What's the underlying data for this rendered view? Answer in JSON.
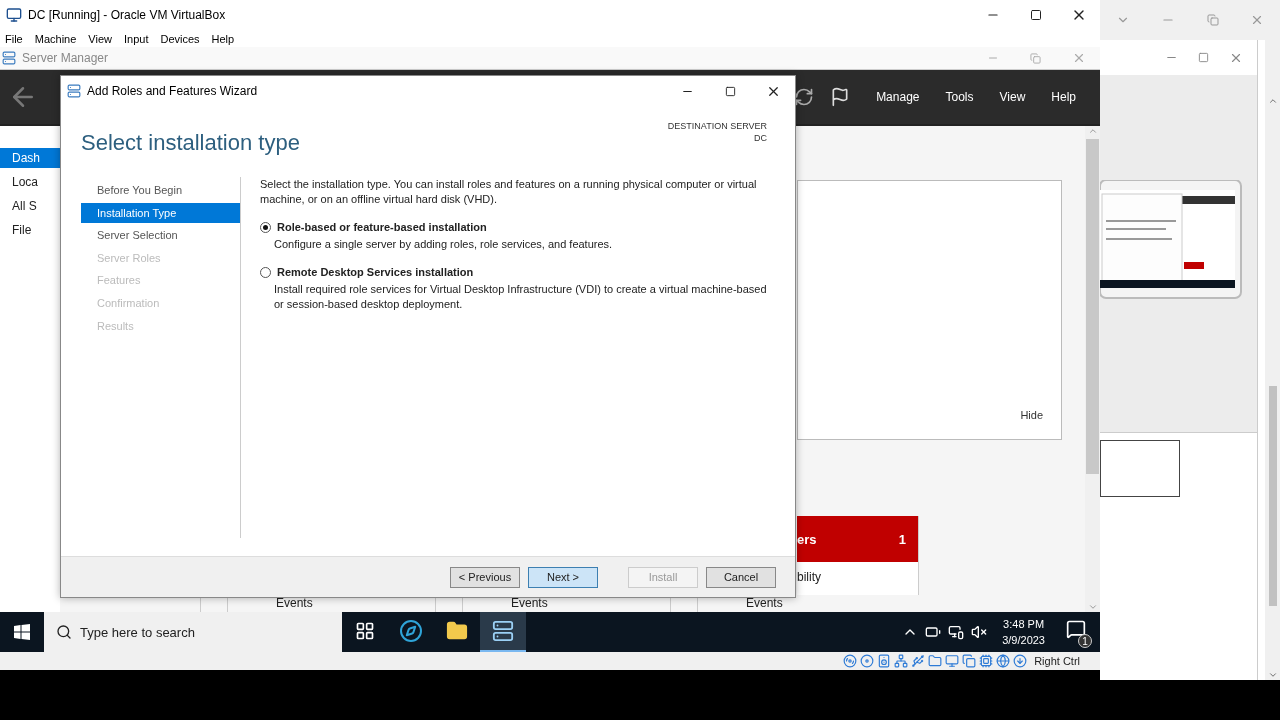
{
  "vbox_window": {
    "title": "DC [Running] - Oracle VM VirtualBox",
    "menu": [
      "File",
      "Machine",
      "View",
      "Input",
      "Devices",
      "Help"
    ],
    "host_key": "Right Ctrl"
  },
  "server_manager": {
    "title": "Server Manager",
    "toolbar_menu": [
      "Manage",
      "Tools",
      "View",
      "Help"
    ],
    "nav": [
      {
        "label": "Dash",
        "selected": true
      },
      {
        "label": "Loca",
        "selected": false
      },
      {
        "label": "All S",
        "selected": false
      },
      {
        "label": "File",
        "selected": false
      }
    ],
    "panel_link": "Hide",
    "tile": {
      "title": "ers",
      "count": "1",
      "item": "bility"
    },
    "events": [
      "Events",
      "Events",
      "Events"
    ]
  },
  "wizard": {
    "title": "Add Roles and Features Wizard",
    "heading": "Select installation type",
    "destination_label": "DESTINATION SERVER",
    "destination_server": "DC",
    "steps": [
      {
        "label": "Before You Begin",
        "selected": false,
        "disabled": false
      },
      {
        "label": "Installation Type",
        "selected": true,
        "disabled": false
      },
      {
        "label": "Server Selection",
        "selected": false,
        "disabled": false
      },
      {
        "label": "Server Roles",
        "selected": false,
        "disabled": true
      },
      {
        "label": "Features",
        "selected": false,
        "disabled": true
      },
      {
        "label": "Confirmation",
        "selected": false,
        "disabled": true
      },
      {
        "label": "Results",
        "selected": false,
        "disabled": true
      }
    ],
    "intro": "Select the installation type. You can install roles and features on a running physical computer or virtual machine, or on an offline virtual hard disk (VHD).",
    "options": [
      {
        "label": "Role-based or feature-based installation",
        "description": "Configure a single server by adding roles, role services, and features.",
        "selected": true
      },
      {
        "label": "Remote Desktop Services installation",
        "description": "Install required role services for Virtual Desktop Infrastructure (VDI) to create a virtual machine-based or session-based desktop deployment.",
        "selected": false
      }
    ],
    "buttons": [
      {
        "label": "< Previous",
        "highlighted": false,
        "disabled": false
      },
      {
        "label": "Next >",
        "highlighted": true,
        "disabled": false
      },
      {
        "label": "Install",
        "highlighted": false,
        "disabled": true
      },
      {
        "label": "Cancel",
        "highlighted": false,
        "disabled": false
      }
    ]
  },
  "taskbar": {
    "search_placeholder": "Type here to search",
    "apps": [
      {
        "kind": "task-view",
        "selected": false
      },
      {
        "kind": "browser",
        "selected": false
      },
      {
        "kind": "folder",
        "selected": false
      },
      {
        "kind": "server-manager",
        "selected": true
      }
    ],
    "time": "3:48 PM",
    "date": "3/9/2023",
    "notification_count": "1"
  }
}
